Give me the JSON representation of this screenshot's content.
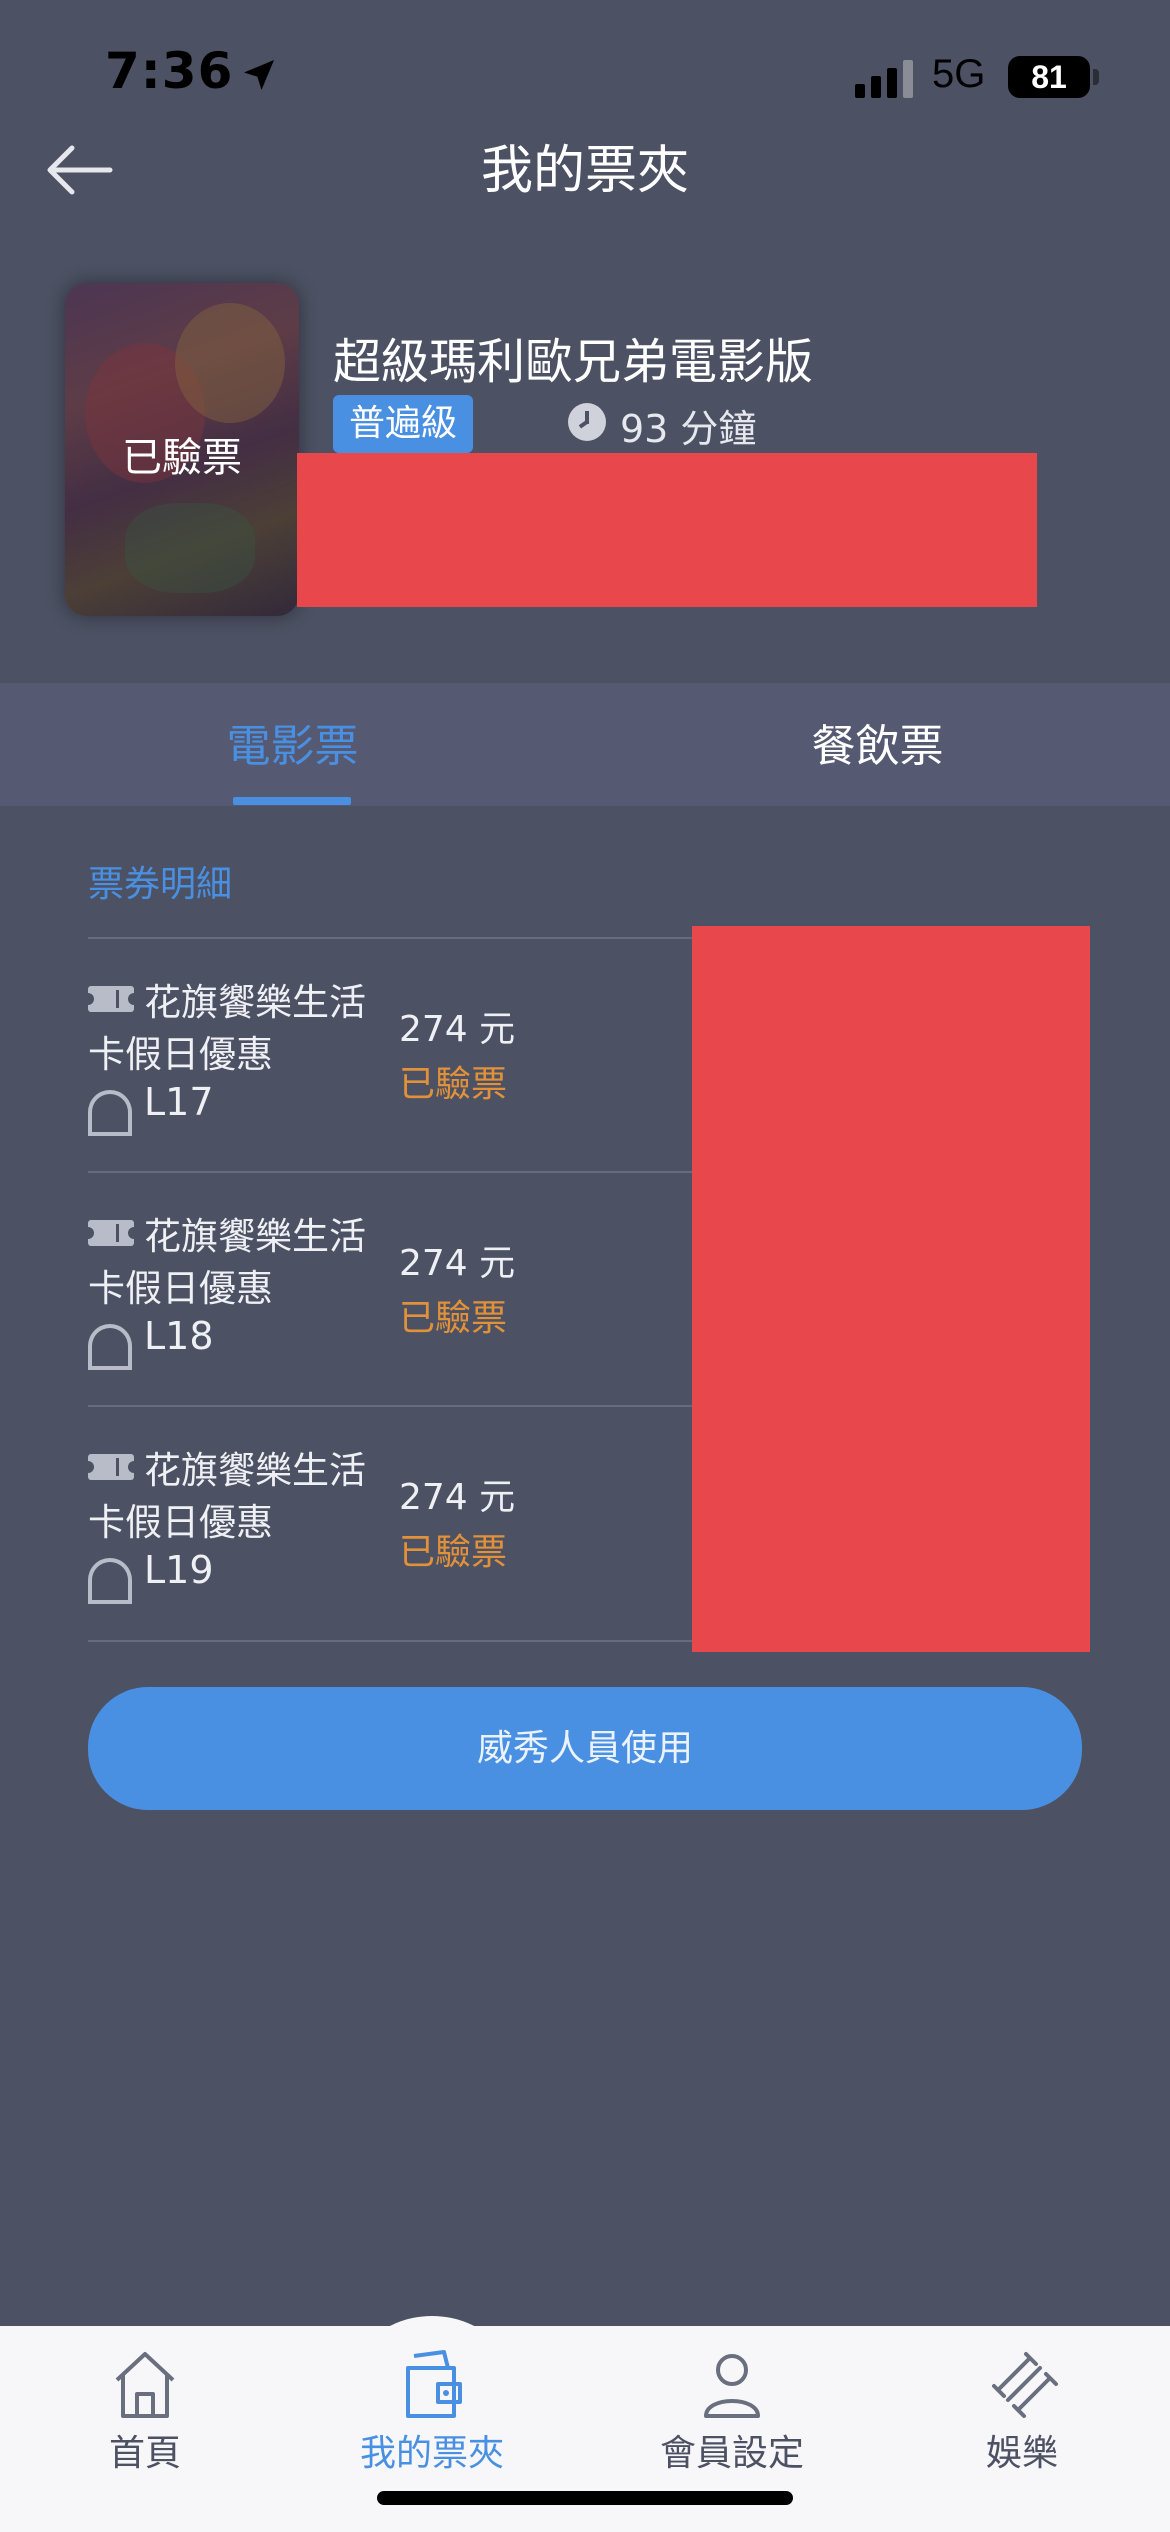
{
  "status_bar": {
    "time": "7:36",
    "network": "5G",
    "battery": "81"
  },
  "header": {
    "title": "我的票夾",
    "back_icon": "arrow-left-icon"
  },
  "movie": {
    "poster_status": "已驗票",
    "title": "超級瑪利歐兄弟電影版",
    "rating": "普遍級",
    "duration": "93 分鐘"
  },
  "tabs": [
    {
      "label": "電影票",
      "active": true
    },
    {
      "label": "餐飲票",
      "active": false
    }
  ],
  "tickets": {
    "section_title": "票券明細",
    "items": [
      {
        "name_line1": "花旗饗樂生活",
        "name_line2": "卡假日優惠",
        "seat": "L17",
        "price": "274 元",
        "status": "已驗票"
      },
      {
        "name_line1": "花旗饗樂生活",
        "name_line2": "卡假日優惠",
        "seat": "L18",
        "price": "274 元",
        "status": "已驗票"
      },
      {
        "name_line1": "花旗饗樂生活",
        "name_line2": "卡假日優惠",
        "seat": "L19",
        "price": "274 元",
        "status": "已驗票"
      }
    ]
  },
  "staff_button": "威秀人員使用",
  "bottom_nav": [
    {
      "label": "首頁",
      "icon": "home-icon",
      "active": false
    },
    {
      "label": "我的票夾",
      "icon": "wallet-icon",
      "active": true
    },
    {
      "label": "會員設定",
      "icon": "user-icon",
      "active": false
    },
    {
      "label": "娛樂",
      "icon": "entertainment-icon",
      "active": false
    }
  ],
  "colors": {
    "background": "#4c5163",
    "accent": "#4a90e2",
    "status_orange": "#e0913a",
    "redaction": "#e8474c"
  }
}
